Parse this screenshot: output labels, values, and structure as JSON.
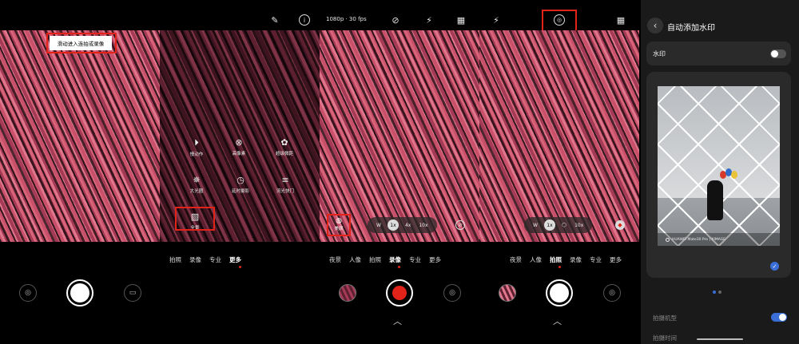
{
  "panel1": {
    "hint": "滑动进入连拍或录像",
    "camera_switch_icon": "camera-switch-icon",
    "video_icon": "video-icon"
  },
  "panel2": {
    "top_icons": [
      "edit-icon",
      "info-icon"
    ],
    "grid": [
      {
        "icon": "slow-motion-icon",
        "label": "慢动作"
      },
      {
        "icon": "high-pixel-icon",
        "label": "高像素"
      },
      {
        "icon": "super-macro-icon",
        "label": "超级微距"
      },
      {
        "icon": "aperture-icon",
        "label": "大光圈"
      },
      {
        "icon": "timelapse-icon",
        "label": "延时摄影"
      },
      {
        "icon": "light-painting-icon",
        "label": "流光快门"
      },
      {
        "icon": "panorama-icon",
        "label": "全景"
      }
    ],
    "modes": [
      "拍照",
      "录像",
      "专业",
      "更多"
    ],
    "active_mode": "更多"
  },
  "panel3": {
    "video_format": "1080p · 30 fps",
    "top_icons": [
      "stabilization-off-icon",
      "flash-off-icon",
      "film-icon"
    ],
    "beauty_label": "美颜",
    "zoom": [
      "W",
      "1x",
      "4x",
      "10x"
    ],
    "zoom_selected": "1x",
    "ai_icon": "ai-off-icon",
    "modes": [
      "夜景",
      "人像",
      "拍照",
      "录像",
      "专业",
      "更多"
    ],
    "active_mode": "录像",
    "chevron": "︿"
  },
  "panel4": {
    "top_icons": [
      "flash-off-icon",
      "aperture-icon",
      "film-icon"
    ],
    "zoom": [
      "W",
      "1x",
      "10x"
    ],
    "zoom_selected": "1x",
    "modes": [
      "夜景",
      "人像",
      "拍照",
      "录像",
      "专业",
      "更多"
    ],
    "active_mode": "拍照",
    "chevron": "︿"
  },
  "settings": {
    "title": "自动添加水印",
    "watermark_label": "水印",
    "watermark_on": false,
    "watermark_text": "HUAWEI Mate30 Pro | XIMAGE",
    "row1_label": "拍摄机型",
    "row1_on": true,
    "row2_label": "拍摄时间"
  },
  "colors": {
    "accent_red": "#e2231a",
    "accent_blue": "#3a6fd8"
  }
}
